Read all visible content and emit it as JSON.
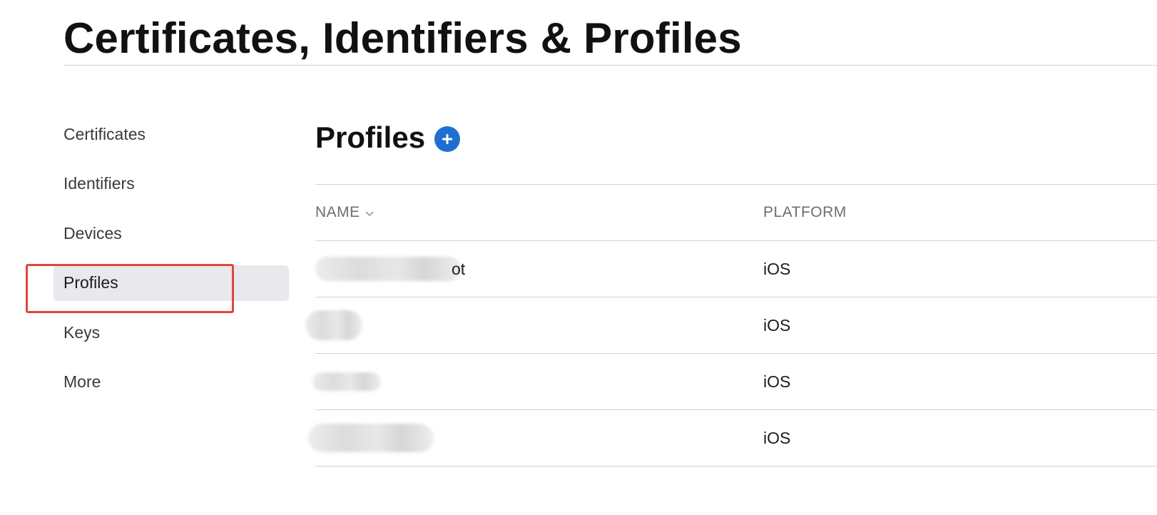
{
  "page": {
    "title": "Certificates, Identifiers & Profiles"
  },
  "sidebar": {
    "items": [
      {
        "label": "Certificates"
      },
      {
        "label": "Identifiers"
      },
      {
        "label": "Devices"
      },
      {
        "label": "Profiles",
        "active": true
      },
      {
        "label": "Keys"
      },
      {
        "label": "More"
      }
    ]
  },
  "main": {
    "section_title": "Profiles",
    "add_icon": "plus-circle-icon",
    "table": {
      "columns": [
        "NAME",
        "PLATFORM"
      ],
      "sort_icon": "chevron-down-icon",
      "rows": [
        {
          "name_visible": "ot",
          "platform": "iOS"
        },
        {
          "name_visible": "",
          "platform": "iOS"
        },
        {
          "name_visible": "",
          "platform": "iOS"
        },
        {
          "name_visible": "",
          "platform": "iOS"
        }
      ]
    }
  },
  "colors": {
    "accent": "#1f6fd1",
    "highlight": "#e2463a",
    "active_bg": "#e8e8ed"
  }
}
